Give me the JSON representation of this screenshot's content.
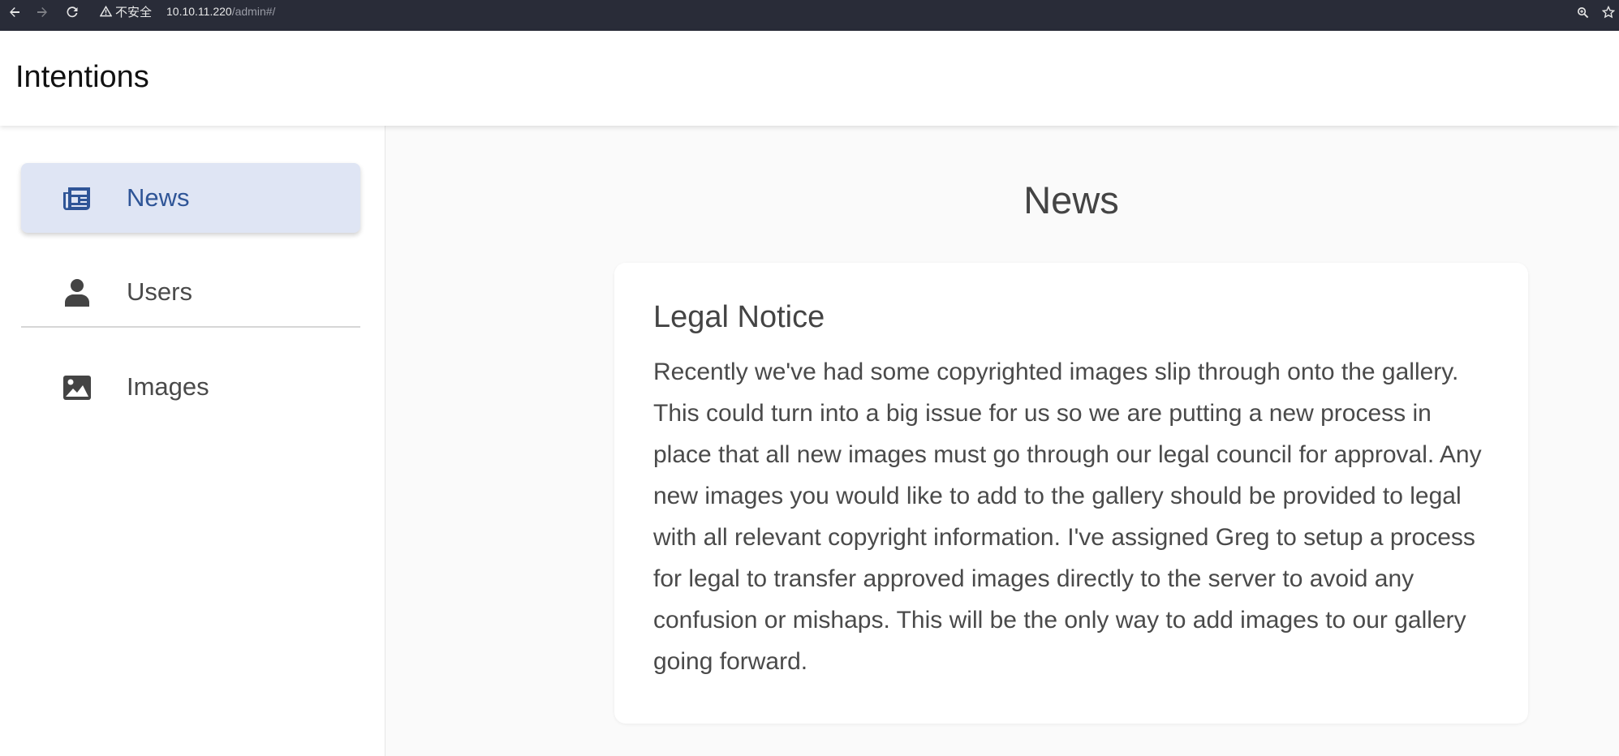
{
  "browser": {
    "security_label": "不安全",
    "url_host": "10.10.11.220",
    "url_path": "/admin#/"
  },
  "app": {
    "title": "Intentions"
  },
  "sidebar": {
    "items": [
      {
        "label": "News",
        "icon": "newspaper-icon",
        "active": true
      },
      {
        "label": "Users",
        "icon": "user-icon",
        "active": false
      },
      {
        "label": "Images",
        "icon": "image-icon",
        "active": false
      }
    ]
  },
  "main": {
    "heading": "News",
    "news": [
      {
        "title": "Legal Notice",
        "body": "Recently we've had some copyrighted images slip through onto the gallery. This could turn into a big issue for us so we are putting a new process in place that all new images must go through our legal council for approval. Any new images you would like to add to the gallery should be provided to legal with all relevant copyright information. I've assigned Greg to setup a process for legal to transfer approved images directly to the server to avoid any confusion or mishaps. This will be the only way to add images to our gallery going forward."
      }
    ]
  },
  "colors": {
    "browser_bar": "#292c38",
    "active_bg": "#dfe5f4",
    "active_text": "#2f5597",
    "text": "#4a4a4a"
  }
}
